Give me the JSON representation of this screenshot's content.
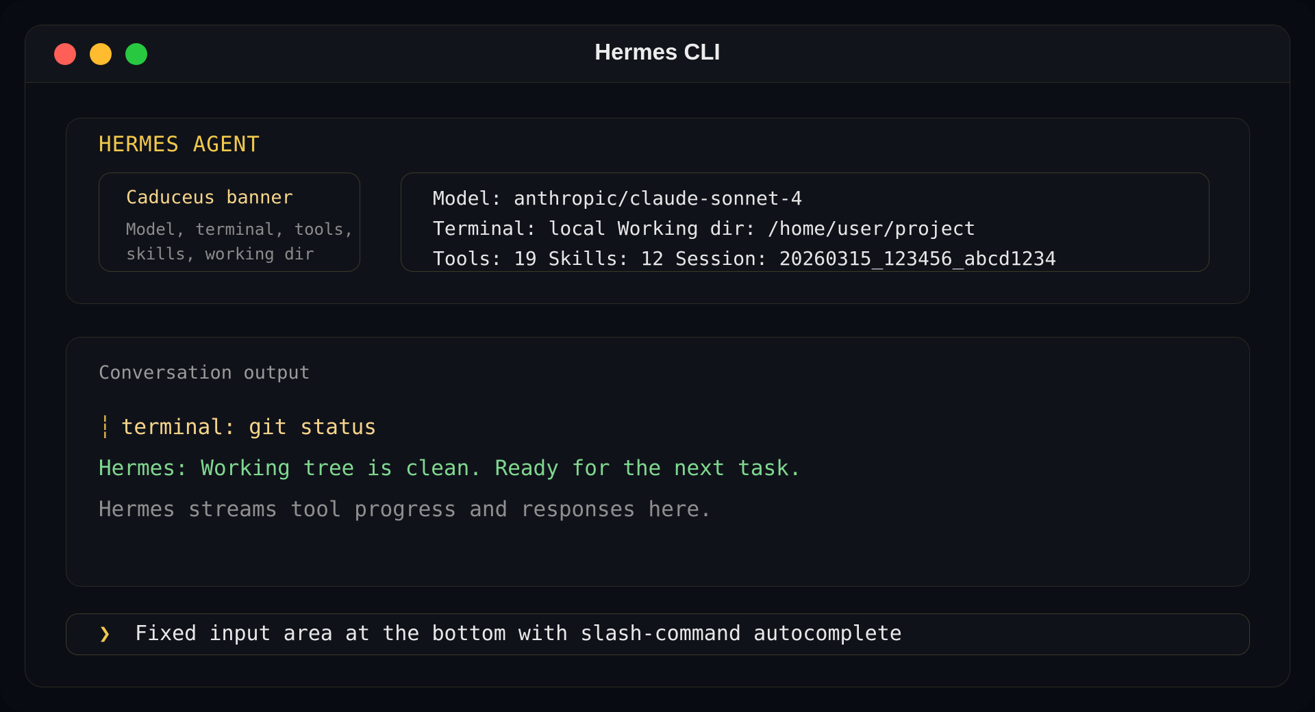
{
  "window": {
    "title": "Hermes CLI",
    "controls": [
      "close",
      "minimize",
      "maximize"
    ]
  },
  "banner": {
    "heading": "HERMES AGENT",
    "caduceus": {
      "title": "Caduceus banner",
      "description": "Model, terminal, tools, skills, working dir"
    },
    "info_lines": [
      "Model: anthropic/claude-sonnet-4",
      "Terminal: local Working dir: /home/user/project",
      "Tools: 19 Skills: 12 Session: 20260315_123456_abcd1234"
    ]
  },
  "output": {
    "heading": "Conversation output",
    "tool_marker": "┆",
    "tool_call": "terminal: git status",
    "response": "Hermes: Working tree is clean. Ready for the next task.",
    "hint": "Hermes streams tool progress and responses here."
  },
  "input": {
    "prompt_glyph": "❯",
    "value": "Fixed input area at the bottom with slash-command autocomplete"
  },
  "colors": {
    "accent": "#f2c94c",
    "success": "#7fd88f",
    "muted": "#8f8f8f",
    "close": "#ff5f57",
    "minimize": "#febc2e",
    "maximize": "#28c840"
  }
}
